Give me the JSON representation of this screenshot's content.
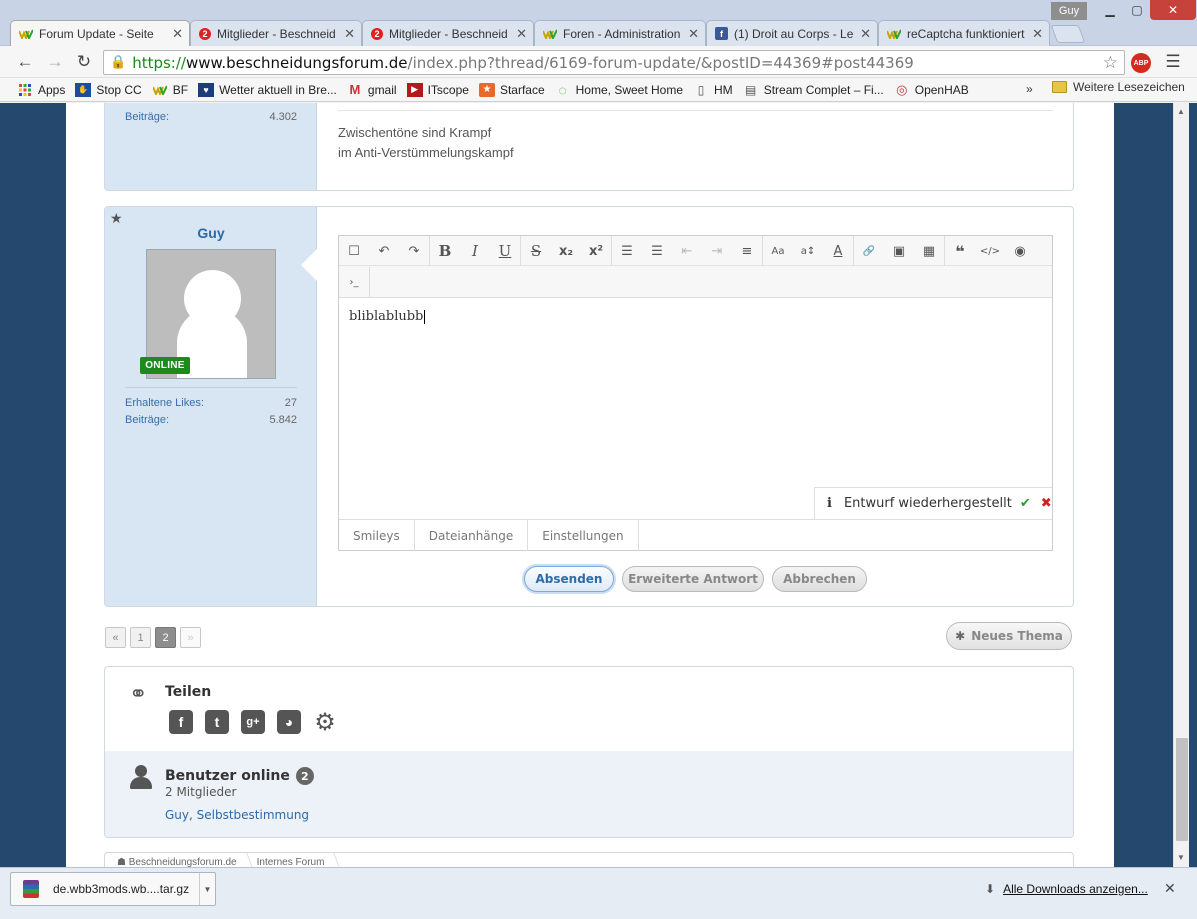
{
  "tabs": [
    {
      "title": "Forum Update - Seite",
      "favicon": "wbb-icon",
      "active": true
    },
    {
      "title": "Mitglieder - Beschneid",
      "favicon": "badge-2-icon",
      "active": false
    },
    {
      "title": "Mitglieder - Beschneid",
      "favicon": "badge-2-icon",
      "active": false
    },
    {
      "title": "Foren - Administration",
      "favicon": "wbb-icon",
      "active": false
    },
    {
      "title": "(1) Droit au Corps - Le",
      "favicon": "facebook-icon",
      "active": false
    },
    {
      "title": "reCaptcha funktioniert",
      "favicon": "wbb-icon",
      "active": false
    }
  ],
  "window": {
    "user": "Guy"
  },
  "url": {
    "scheme": "https://",
    "host": "www.beschneidungsforum.de",
    "path": "/index.php?thread/6169-forum-update/&postID=44369#post44369"
  },
  "extensions": {
    "abp": "ABP"
  },
  "bookmarks": [
    {
      "label": "Apps",
      "icon": "apps-grid-icon"
    },
    {
      "label": "Stop CC",
      "icon": "stop-cc-icon"
    },
    {
      "label": "BF",
      "icon": "wbb-icon"
    },
    {
      "label": "Wetter aktuell in Bre...",
      "icon": "weather-icon"
    },
    {
      "label": "gmail",
      "icon": "gmail-icon"
    },
    {
      "label": "ITscope",
      "icon": "itscope-icon"
    },
    {
      "label": "Starface",
      "icon": "starface-icon"
    },
    {
      "label": "Home, Sweet Home",
      "icon": "home-icon"
    },
    {
      "label": "HM",
      "icon": "document-icon"
    },
    {
      "label": "Stream Complet – Fi...",
      "icon": "film-icon"
    },
    {
      "label": "OpenHAB",
      "icon": "openhab-icon"
    }
  ],
  "bookmarks_more": "»",
  "bookmarks_folder": "Weitere Lesezeichen",
  "post1": {
    "stat_label": "Beiträge:",
    "stat_value": "4.302",
    "signature": [
      "Zwischentöne sind Krampf",
      "im Anti-Verstümmelungskampf"
    ]
  },
  "post2": {
    "username": "Guy",
    "online_label": "ONLINE",
    "stats": [
      {
        "label": "Erhaltene Likes:",
        "value": "27"
      },
      {
        "label": "Beiträge:",
        "value": "5.842"
      }
    ]
  },
  "editor": {
    "toolbar_row1": [
      [
        "☐",
        "↶",
        "↷"
      ],
      [
        "B",
        "I",
        "U"
      ],
      [
        "S",
        "x₂",
        "x²"
      ],
      [
        "☰",
        "☰",
        "⇤",
        "⇥",
        "≡"
      ],
      [
        "Aa",
        "a↕",
        "A"
      ],
      [
        "🔗",
        "▣",
        "▦"
      ],
      [
        "❝",
        "</>",
        "◉"
      ]
    ],
    "toolbar_row2": [
      "›_"
    ],
    "content": "bliblablubb",
    "draft_notice": "Entwurf wiederhergestellt",
    "draft_info": "i",
    "draft_accept": "✔",
    "draft_discard": "✖",
    "tabs": [
      "Smileys",
      "Dateianhänge",
      "Einstellungen"
    ]
  },
  "form_buttons": {
    "send": "Absenden",
    "advanced": "Erweiterte Antwort",
    "cancel": "Abbrechen"
  },
  "pagination": {
    "prev": "«",
    "pages": [
      "1",
      "2"
    ],
    "current": "2",
    "next": "»"
  },
  "new_thread": "Neues Thema",
  "share": {
    "title": "Teilen",
    "networks": [
      "facebook-icon",
      "twitter-icon",
      "google-plus-icon",
      "reddit-icon",
      "gear-icon"
    ]
  },
  "users_online": {
    "title": "Benutzer online",
    "count": "2",
    "subtitle": "2 Mitglieder",
    "names": "Guy, Selbstbestimmung"
  },
  "breadcrumb": [
    "Beschneidungsforum.de",
    "Internes Forum"
  ],
  "download": {
    "file": "de.wbb3mods.wb....tar.gz",
    "show_all": "Alle Downloads anzeigen..."
  }
}
